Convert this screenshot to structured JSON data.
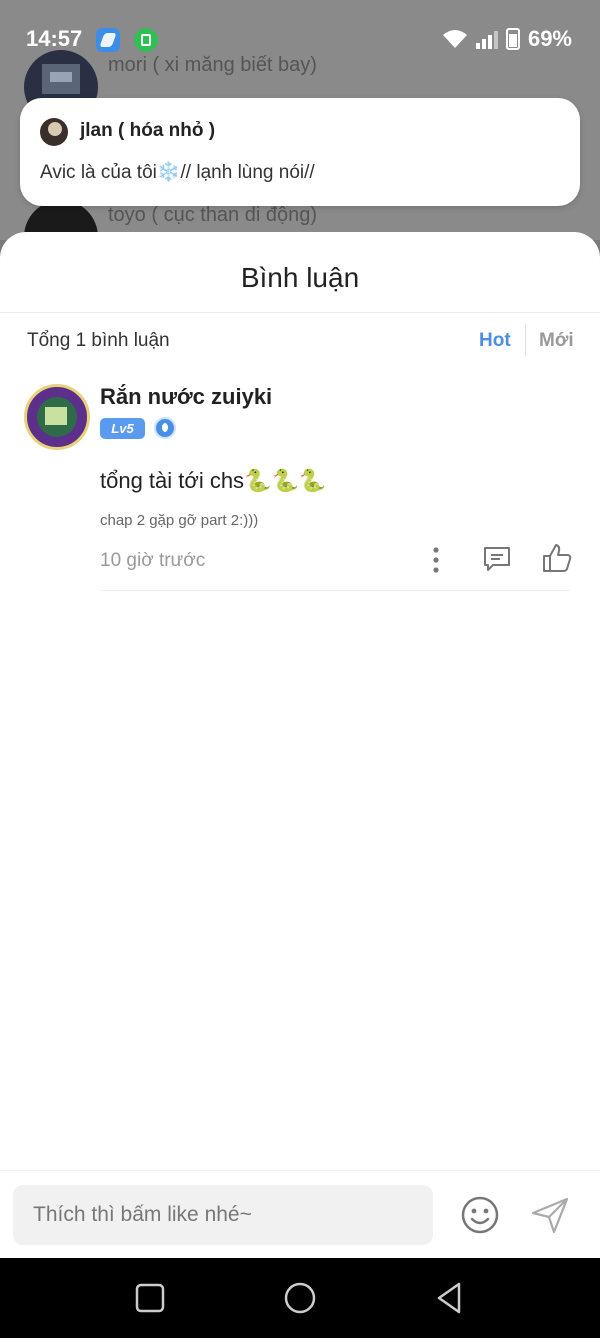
{
  "status_bar": {
    "time": "14:57",
    "battery": "69%",
    "icons": [
      "blue-app-icon",
      "green-app-icon",
      "wifi-icon",
      "signal-icon",
      "battery-icon"
    ]
  },
  "background": {
    "rows": [
      {
        "name": "mori ( xi măng biết bay)"
      },
      {
        "name": "toyo ( cục than di động)"
      }
    ]
  },
  "notification": {
    "sender": "jlan ( hóa nhỏ )",
    "message": "Avic là của tôi❄️// lạnh lùng nói//"
  },
  "comments_sheet": {
    "title": "Bình luận",
    "total": "Tổng 1 bình luận",
    "sort": {
      "hot": "Hot",
      "new": "Mới"
    },
    "comments": [
      {
        "user": "Rắn nước zuiyki",
        "level": "Lv5",
        "text": "tổng tài tới chs🐍🐍🐍",
        "chapter": "chap 2 gặp gỡ part 2:)))",
        "time": "10 giờ trước"
      }
    ]
  },
  "input": {
    "placeholder": "Thích thì bấm like nhé~"
  },
  "colors": {
    "accent": "#4a90e2",
    "badge": "#5a9bf0",
    "overlay": "#8a8a8a"
  }
}
